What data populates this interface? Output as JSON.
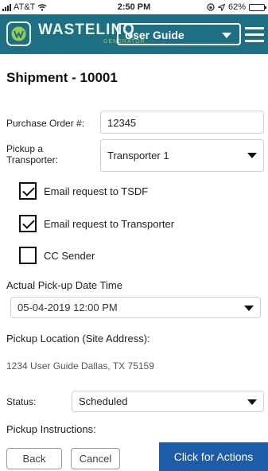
{
  "status_bar": {
    "carrier": "AT&T",
    "time": "2:50 PM",
    "battery": "62%",
    "battery_fraction": 0.62
  },
  "header": {
    "logo_text": "WASTELINQ",
    "logo_sub": "GENERATOR",
    "guide_select": "User Guide",
    "colors": {
      "header_bg": "#1e6f84",
      "logo_green": "#9acb52",
      "primary_button": "#1e5ba8"
    }
  },
  "page": {
    "title": "Shipment - 10001"
  },
  "form": {
    "po_label": "Purchase Order #:",
    "po_value": "12345",
    "transporter_label_line1": "Pickup a",
    "transporter_label_line2": "Transporter:",
    "transporter_value": "Transporter 1",
    "checkboxes": [
      {
        "label": "Email request to TSDF",
        "checked": true
      },
      {
        "label": "Email request to Transporter",
        "checked": true
      },
      {
        "label": "CC Sender",
        "checked": false
      }
    ],
    "pickup_datetime_label": "Actual Pick-up Date Time",
    "pickup_datetime_value": "05-04-2019 12:00 PM",
    "pickup_location_label": "Pickup Location (Site Address):",
    "pickup_location_value": "1234 User Guide Dallas, TX 75159",
    "status_label": "Status:",
    "status_value": "Scheduled",
    "instructions_label": "Pickup Instructions:"
  },
  "actions": {
    "back_label": "Back",
    "cancel_label": "Cancel",
    "actions_label": "Click for Actions"
  }
}
